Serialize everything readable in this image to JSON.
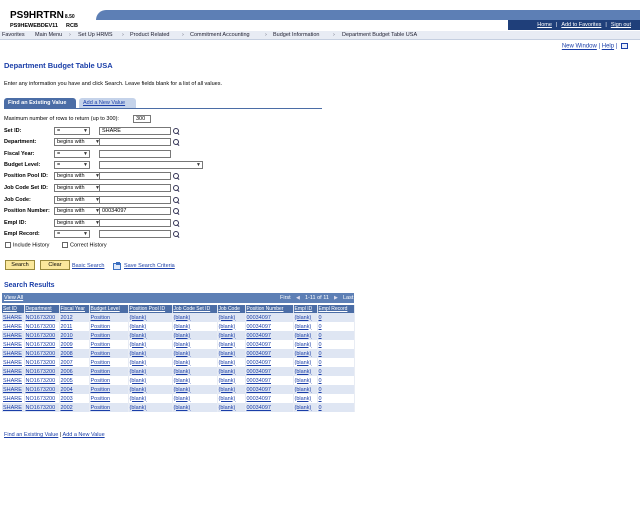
{
  "header": {
    "app_name": "PS9HRTRN",
    "version": "8.50",
    "database": "PS9HEWEBDEV11",
    "user": "RCB",
    "links": [
      "Home",
      "Add to Favorites",
      "Sign out"
    ]
  },
  "nav": {
    "items": [
      "Favorites",
      "Main Menu",
      "Set Up HRMS",
      "Product Related",
      "Commitment Accounting",
      "Budget Information",
      "Department Budget Table USA"
    ]
  },
  "top_links": {
    "new_window": "New Window",
    "help": "Help",
    "separator": "|"
  },
  "page": {
    "title": "Department Budget Table USA",
    "instructions": "Enter any information you have and click Search. Leave fields blank for a list of all values."
  },
  "tabs": [
    "Find an Existing Value",
    "Add a New Value"
  ],
  "max_rows": {
    "label": "Maximum number of rows to return (up to 300):",
    "value": "300"
  },
  "fields": [
    {
      "label": "Set ID:",
      "operator": "=",
      "value": "SHARE"
    },
    {
      "label": "Department:",
      "operator": "begins with",
      "value": ""
    },
    {
      "label": "Fiscal Year:",
      "operator": "=",
      "value": ""
    },
    {
      "label": "Budget Level:",
      "operator": "=",
      "value": ""
    },
    {
      "label": "Position Pool ID:",
      "operator": "begins with",
      "value": ""
    },
    {
      "label": "Job Code Set ID:",
      "operator": "begins with",
      "value": ""
    },
    {
      "label": "Job Code:",
      "operator": "begins with",
      "value": ""
    },
    {
      "label": "Position Number:",
      "operator": "begins with",
      "value": "00034097"
    },
    {
      "label": "Empl ID:",
      "operator": "begins with",
      "value": ""
    },
    {
      "label": "Empl Record:",
      "operator": "=",
      "value": ""
    }
  ],
  "checkboxes": [
    "Include History",
    "Correct History"
  ],
  "buttons": {
    "search": "Search",
    "clear": "Clear",
    "basic_search": "Basic Search",
    "save_criteria": "Save Search Criteria"
  },
  "results": {
    "title": "Search Results",
    "view_all": "View All",
    "first": "First",
    "count": "1-11 of 11",
    "last": "Last",
    "columns": [
      "Set ID",
      "Department",
      "Fiscal Year",
      "Budget Level",
      "Position Pool ID",
      "Job Code Set ID",
      "Job Code",
      "Position Number",
      "Empl ID",
      "Empl Record"
    ],
    "rows": [
      [
        "SHARE",
        "NO1673200",
        "2012",
        "Position",
        "(blank)",
        "(blank)",
        "(blank)",
        "00034097",
        "(blank)",
        "0"
      ],
      [
        "SHARE",
        "NO1673200",
        "2011",
        "Position",
        "(blank)",
        "(blank)",
        "(blank)",
        "00034097",
        "(blank)",
        "0"
      ],
      [
        "SHARE",
        "NO1673200",
        "2010",
        "Position",
        "(blank)",
        "(blank)",
        "(blank)",
        "00034097",
        "(blank)",
        "0"
      ],
      [
        "SHARE",
        "NO1673200",
        "2009",
        "Position",
        "(blank)",
        "(blank)",
        "(blank)",
        "00034097",
        "(blank)",
        "0"
      ],
      [
        "SHARE",
        "NO1673200",
        "2008",
        "Position",
        "(blank)",
        "(blank)",
        "(blank)",
        "00034097",
        "(blank)",
        "0"
      ],
      [
        "SHARE",
        "NO1673200",
        "2007",
        "Position",
        "(blank)",
        "(blank)",
        "(blank)",
        "00034097",
        "(blank)",
        "0"
      ],
      [
        "SHARE",
        "NO1673200",
        "2006",
        "Position",
        "(blank)",
        "(blank)",
        "(blank)",
        "00034097",
        "(blank)",
        "0"
      ],
      [
        "SHARE",
        "NO1673200",
        "2005",
        "Position",
        "(blank)",
        "(blank)",
        "(blank)",
        "00034097",
        "(blank)",
        "0"
      ],
      [
        "SHARE",
        "NO1673200",
        "2004",
        "Position",
        "(blank)",
        "(blank)",
        "(blank)",
        "00034097",
        "(blank)",
        "0"
      ],
      [
        "SHARE",
        "NO1673200",
        "2003",
        "Position",
        "(blank)",
        "(blank)",
        "(blank)",
        "00034097",
        "(blank)",
        "0"
      ],
      [
        "SHARE",
        "NO1673200",
        "2002",
        "Position",
        "(blank)",
        "(blank)",
        "(blank)",
        "00034097",
        "(blank)",
        "0"
      ]
    ]
  },
  "bottom_links": {
    "find": "Find an Existing Value",
    "separator": "|",
    "add": "Add a New Value"
  }
}
